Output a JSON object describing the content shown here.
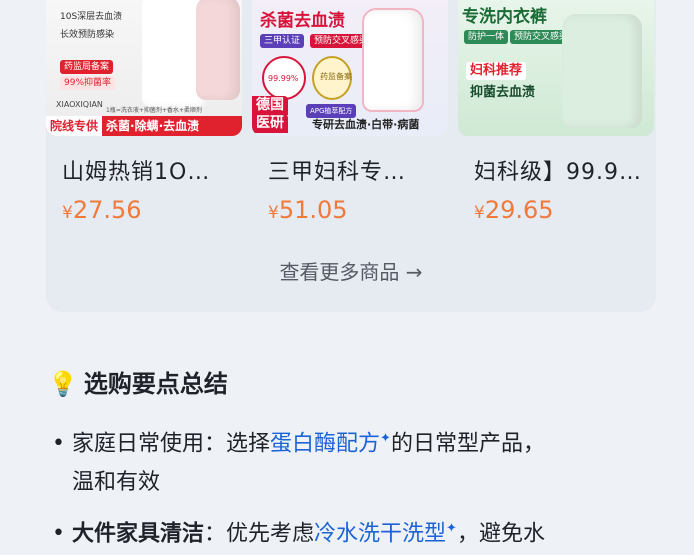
{
  "products": [
    {
      "title": "山姆热销1O…",
      "price_symbol": "¥",
      "price": "27.56",
      "image_texts": [
        "10S深层去血渍",
        "长效预防感染",
        "药监局备案",
        "99%抑菌率",
        "XIAOXIQIAN",
        "1瓶=洗衣液+抑菌剂+香水+柔顺剂"
      ],
      "ribbon_lead": "院线专供",
      "ribbon_text": "杀菌·除螨·去血渍"
    },
    {
      "title": "三甲妇科专…",
      "price_symbol": "¥",
      "price": "51.05",
      "image_texts": [
        "杀菌去血渍",
        "三甲认证",
        "预防交叉感染",
        "99.99%",
        "药监备案",
        "德国",
        "医研",
        "APG植萃配方",
        "专研去血渍·白带·病菌"
      ]
    },
    {
      "title": "妇科级】99.9…",
      "price_symbol": "¥",
      "price": "29.65",
      "image_texts": [
        "专洗内衣裤",
        "防护一体",
        "预防交叉感染",
        "妇科推荐",
        "抑菌去血渍"
      ]
    }
  ],
  "more_link": "查看更多商品 →",
  "tips": {
    "icon": "lightbulb-icon",
    "heading": "选购要点总结",
    "items": [
      {
        "bullet": "•",
        "prefix": "家庭日常使用：选择",
        "link": "蛋白酶配方",
        "spark": "✦",
        "suffix": "的日常型产品，",
        "line2": "温和有效"
      },
      {
        "bullet": "•",
        "head": "大件家具清洁",
        "prefix": "：优先考虑",
        "link": "冷水洗干洗型",
        "spark": "✦",
        "suffix": "，避免水"
      }
    ]
  },
  "colors": {
    "price": "#f07a3c",
    "link": "#1c64d6",
    "ribbon_red": "#e0222f"
  }
}
